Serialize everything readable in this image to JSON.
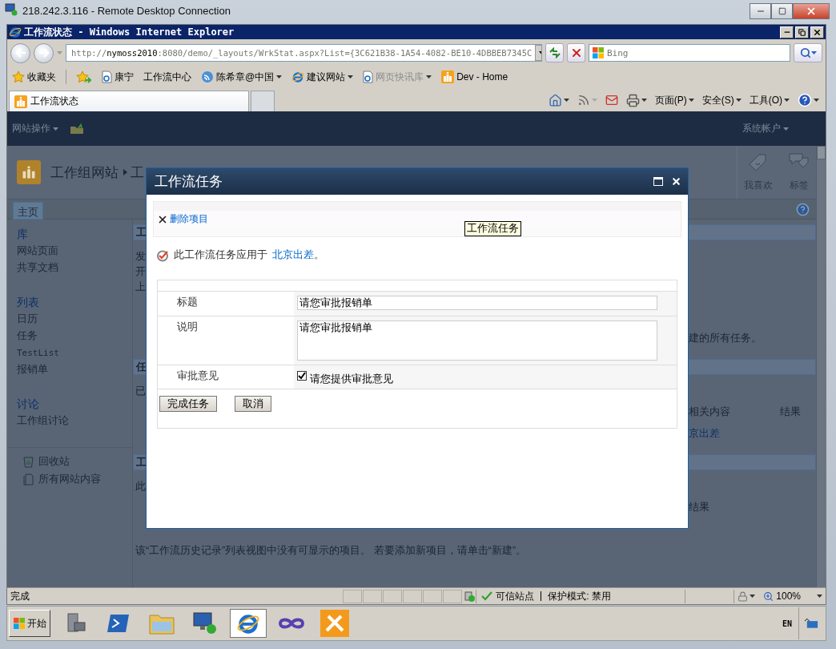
{
  "remote_window": {
    "title": "218.242.3.116 - Remote Desktop Connection"
  },
  "browser": {
    "title": "工作流状态 - Windows Internet Explorer",
    "address": {
      "scheme": "http://",
      "host": "nymoss2010",
      "rest": ":8080/demo/_layouts/WrkStat.aspx?List={3C621B38-1A54-4082-BE10-4DBBEB7345C"
    },
    "search": {
      "placeholder": "Bing"
    },
    "favorites_label": "收藏夹",
    "favorites": [
      {
        "label": "康宁",
        "kind": "page",
        "dropdown": false,
        "disabled": false
      },
      {
        "label": "工作流中心",
        "kind": "none",
        "dropdown": false,
        "disabled": false
      },
      {
        "label": "陈希章@中国",
        "kind": "feed",
        "dropdown": true,
        "disabled": false
      },
      {
        "label": "建议网站",
        "kind": "browser",
        "dropdown": true,
        "disabled": false
      },
      {
        "label": "网页快讯库",
        "kind": "page",
        "dropdown": true,
        "disabled": true
      },
      {
        "label": "Dev - Home",
        "kind": "site",
        "dropdown": false,
        "disabled": false
      }
    ],
    "tabs": [
      {
        "label": "工作流状态",
        "selected": true
      }
    ],
    "commands": [
      {
        "kind": "home",
        "dropdown": true
      },
      {
        "kind": "feeds",
        "dropdown": true
      },
      {
        "kind": "mail",
        "dropdown": false
      },
      {
        "kind": "print",
        "dropdown": true
      },
      {
        "kind": "menu",
        "label": "页面(P)",
        "dropdown": true
      },
      {
        "kind": "menu",
        "label": "安全(S)",
        "dropdown": true
      },
      {
        "kind": "menu",
        "label": "工具(O)",
        "dropdown": true
      },
      {
        "kind": "help",
        "dropdown": true
      }
    ],
    "status": {
      "text": "完成",
      "zone": "可信站点",
      "protected_mode": "保护模式: 禁用",
      "zoom": "100%"
    }
  },
  "site": {
    "site_actions": "网站操作",
    "user": "系统帐户",
    "title": "工作组网站",
    "breadcrumb_fragment": "工",
    "ribbon_actions": [
      {
        "label": "我喜欢",
        "kind": "like"
      },
      {
        "label": "标签",
        "kind": "tags"
      }
    ],
    "top_nav": [
      {
        "label": "主页",
        "selected": true
      }
    ],
    "quick_launch": [
      {
        "heading": "库",
        "items": [
          "网站页面",
          "共享文档"
        ]
      },
      {
        "heading": "列表",
        "items": [
          "日历",
          "任务",
          "TestList",
          "报销单"
        ]
      },
      {
        "heading": "讨论",
        "items": [
          "工作组讨论"
        ]
      }
    ],
    "quick_launch_footer": [
      {
        "label": "回收站",
        "kind": "recycle"
      },
      {
        "label": "所有网站内容",
        "kind": "content"
      }
    ],
    "background_rows": [
      {
        "kind": "header",
        "left": "工"
      },
      {
        "kind": "line",
        "left": "发"
      },
      {
        "kind": "line",
        "left": "开"
      },
      {
        "kind": "line",
        "left": "上"
      },
      {
        "kind": "note",
        "right": [
          "建的所有任务。"
        ]
      },
      {
        "kind": "header",
        "left": "任"
      },
      {
        "kind": "line",
        "left": "已"
      },
      {
        "kind": "columns",
        "right": [
          "相关内容",
          "结果"
        ]
      },
      {
        "kind": "link",
        "right": [
          "京出差"
        ]
      },
      {
        "kind": "header",
        "left": "工"
      },
      {
        "kind": "line",
        "left": "此"
      },
      {
        "kind": "columns",
        "right": [
          "结果"
        ]
      }
    ],
    "footer_note": "该“工作流历史记录”列表视图中没有可显示的项目。 若要添加新项目，请单击“新建”。"
  },
  "dialog": {
    "title": "工作流任务",
    "tooltip": "工作流任务",
    "delete_action": "删除项目",
    "applies_to": {
      "text": "此工作流任务应用于",
      "link": "北京出差",
      "end": "。"
    },
    "fields": [
      {
        "label": "标题",
        "kind": "text",
        "value": "请您审批报销单"
      },
      {
        "label": "说明",
        "kind": "textarea",
        "value": "请您审批报销单"
      },
      {
        "label": "审批意见",
        "kind": "checkbox",
        "checked": true,
        "text": "请您提供审批意见"
      }
    ],
    "buttons": [
      "完成任务",
      "取消"
    ]
  },
  "taskbar": {
    "start": "开始",
    "language": "EN",
    "apps": [
      {
        "kind": "server",
        "selected": false
      },
      {
        "kind": "shell",
        "selected": false
      },
      {
        "kind": "folder",
        "selected": false
      },
      {
        "kind": "remote",
        "selected": false
      },
      {
        "kind": "browser",
        "selected": true
      },
      {
        "kind": "infinity",
        "selected": false
      },
      {
        "kind": "tools",
        "selected": false
      }
    ]
  }
}
